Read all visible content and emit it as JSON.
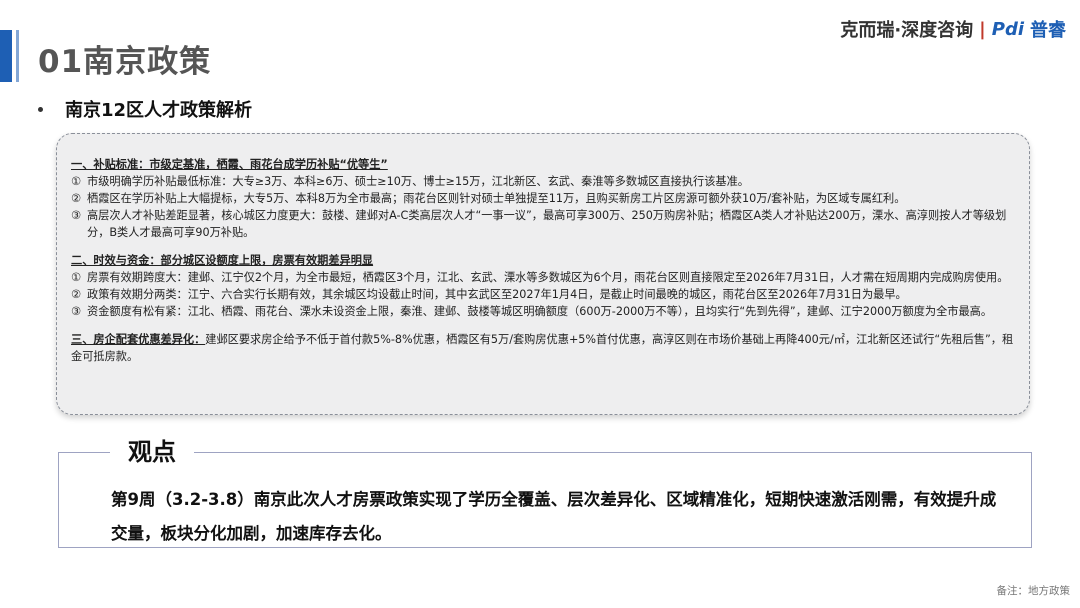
{
  "header": {
    "title": "01南京政策",
    "brand_text": "克而瑞·深度咨询",
    "brand_logo_mark": "Pdi",
    "brand_logo_cn": "普睿"
  },
  "subtitle": "南京12区人才政策解析",
  "policy": {
    "sec1_title": "一、补贴标准：市级定基准，栖霞、雨花台成学历补贴“优等生”",
    "sec1_items": [
      {
        "num": "①",
        "text": "市级明确学历补贴最低标准：大专≥3万、本科≥6万、硕士≥10万、博士≥15万，江北新区、玄武、秦淮等多数城区直接执行该基准。"
      },
      {
        "num": "②",
        "text": "栖霞区在学历补贴上大幅提标，大专5万、本科8万为全市最高；雨花台区则针对硕士单独提至11万，且购买新房工片区房源可额外获10万/套补贴，为区域专属红利。"
      },
      {
        "num": "③",
        "text": "高层次人才补贴差距显著，核心城区力度更大：鼓楼、建邺对A-C类高层次人才“一事一议”，最高可享300万、250万购房补贴；栖霞区A类人才补贴达200万，溧水、高淳则按人才等级划分，B类人才最高可享90万补贴。"
      }
    ],
    "sec2_title": "二、时效与资金：部分城区设额度上限，房票有效期差异明显",
    "sec2_items": [
      {
        "num": "①",
        "text": "房票有效期跨度大：建邺、江宁仅2个月，为全市最短，栖霞区3个月，江北、玄武、溧水等多数城区为6个月，雨花台区则直接限定至2026年7月31日，人才需在短周期内完成购房使用。"
      },
      {
        "num": "②",
        "text": "政策有效期分两类：江宁、六合实行长期有效，其余城区均设截止时间，其中玄武区至2027年1月4日，是截止时间最晚的城区，雨花台区至2026年7月31日为最早。"
      },
      {
        "num": "③",
        "text": "资金额度有松有紧：江北、栖霞、雨花台、溧水未设资金上限，秦淮、建邺、鼓楼等城区明确额度（600万-2000万不等），且均实行“先到先得”，建邺、江宁2000万额度为全市最高。"
      }
    ],
    "sec3_title": "三、房企配套优惠差异化：",
    "sec3_text": "建邺区要求房企给予不低于首付款5%-8%优惠，栖霞区有5万/套购房优惠+5%首付优惠，高淳区则在市场价基础上再降400元/㎡，江北新区还试行“先租后售”，租金可抵房款。"
  },
  "viewpoint": {
    "label": "观点",
    "text": "第9周（3.2-3.8）南京此次人才房票政策实现了学历全覆盖、层次差异化、区域精准化，短期快速激活刚需，有效提升成交量，板块分化加剧，加速库存去化。"
  },
  "footnote": "备注：地方政策"
}
